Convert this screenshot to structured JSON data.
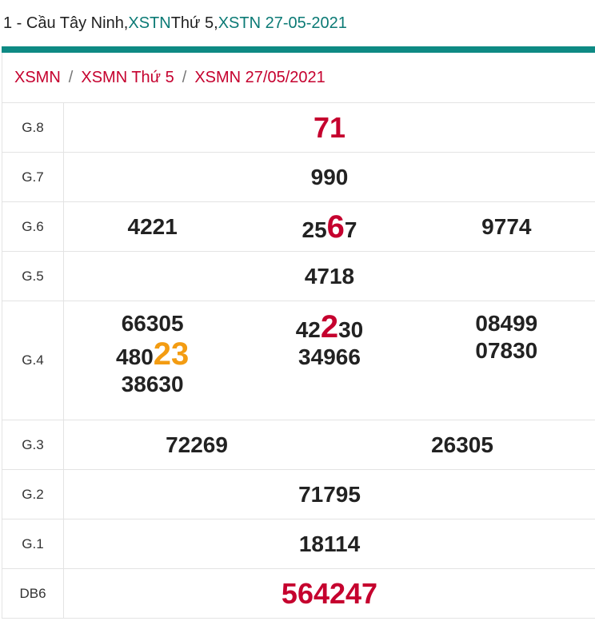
{
  "header": {
    "prefix": "1 - Cầu Tây Ninh, ",
    "link1": "XSTN",
    "mid": " Thứ 5, ",
    "link2": "XSTN 27-05-2021"
  },
  "breadcrumb": {
    "item1": "XSMN",
    "sep": "/",
    "item2": "XSMN Thứ 5",
    "item3": "XSMN 27/05/2021"
  },
  "results": {
    "g8": {
      "label": "G.8",
      "value": "71"
    },
    "g7": {
      "label": "G.7",
      "value": "990"
    },
    "g6": {
      "label": "G.6",
      "v1": "4221",
      "v2_pre": "25",
      "v2_hl": "6",
      "v2_post": "7",
      "v3": "9774"
    },
    "g5": {
      "label": "G.5",
      "value": "4718"
    },
    "g4": {
      "label": "G.4",
      "c1": {
        "n1": "66305",
        "n2_pre": "480",
        "n2_hl": "23",
        "n3": "38630"
      },
      "c2": {
        "n1_pre": "42",
        "n1_hl": "2",
        "n1_post": "30",
        "n2": "34966"
      },
      "c3": {
        "n1": "08499",
        "n2": "07830"
      }
    },
    "g3": {
      "label": "G.3",
      "v1": "72269",
      "v2": "26305"
    },
    "g2": {
      "label": "G.2",
      "value": "71795"
    },
    "g1": {
      "label": "G.1",
      "value": "18114"
    },
    "db": {
      "label": "DB6",
      "value": "564247"
    }
  },
  "colors": {
    "accent": "#0e8a84",
    "link": "#0b7a75",
    "red": "#c5002e",
    "orange": "#f39c12"
  }
}
